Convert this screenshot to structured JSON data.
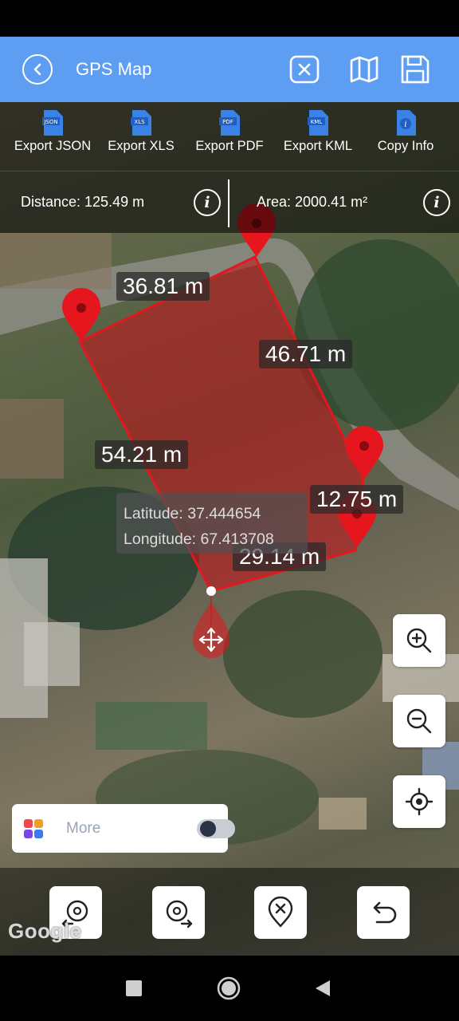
{
  "app_bar": {
    "title": "GPS Map",
    "color": "#5d9ef2",
    "icons": [
      "back-icon",
      "close-square-icon",
      "map-icon",
      "save-icon"
    ]
  },
  "export_bar": {
    "items": [
      {
        "label": "Export JSON",
        "icon": "json-file-icon",
        "badge": "JSON"
      },
      {
        "label": "Export XLS",
        "icon": "xls-file-icon",
        "badge": "XLS"
      },
      {
        "label": "Export PDF",
        "icon": "pdf-file-icon",
        "badge": "PDF"
      },
      {
        "label": "Export KML",
        "icon": "kml-file-icon",
        "badge": "KML"
      },
      {
        "label": "Copy Info",
        "icon": "info-file-icon",
        "badge": "i"
      }
    ]
  },
  "measurements": {
    "distance": "Distance: 125.49 m",
    "area": "Area: 2000.41 m²"
  },
  "segments": [
    "36.81 m",
    "46.71 m",
    "54.21 m",
    "12.75 m",
    "29.14 m"
  ],
  "coordinates": {
    "latitude": "Latitude: 37.444654",
    "longitude": "Longitude: 67.413708"
  },
  "map": {
    "polygon_fill": "#c0181e",
    "marker_color": "#e5161e",
    "attribution": "Google"
  },
  "more_card": {
    "label": "More",
    "toggle_on": false
  },
  "tools": [
    "rotate-left-icon",
    "rotate-right-icon",
    "delete-point-icon",
    "undo-icon"
  ],
  "zoom": [
    "zoom-in-icon",
    "zoom-out-icon",
    "my-location-icon"
  ]
}
